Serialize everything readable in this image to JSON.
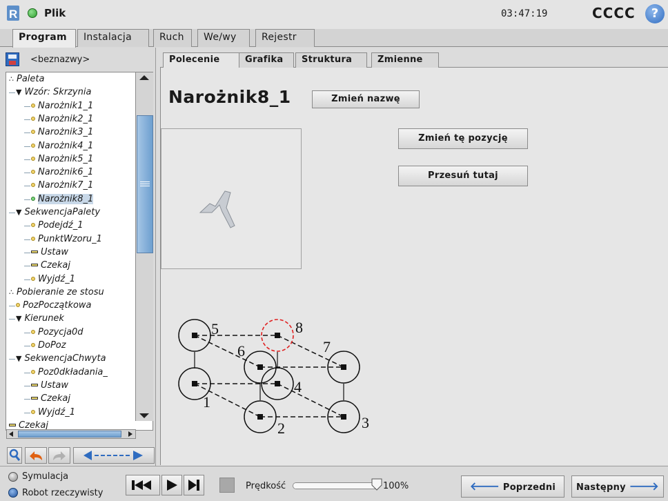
{
  "header": {
    "app_label": "Plik",
    "time": "03:47:19",
    "robot_name": "CCCC",
    "help_glyph": "?"
  },
  "main_tabs": [
    "Program",
    "Instalacja",
    "Ruch",
    "We/wy",
    "Rejestr"
  ],
  "program_name": "<beznazwy>",
  "tree": [
    {
      "label": "Paleta",
      "icon": "group",
      "indent": 0
    },
    {
      "label": "Wzór: Skrzynia",
      "icon": "expand",
      "indent": 1
    },
    {
      "label": "Narożnik1_1",
      "icon": "waypoint",
      "indent": 2
    },
    {
      "label": "Narożnik2_1",
      "icon": "waypoint",
      "indent": 2
    },
    {
      "label": "Narożnik3_1",
      "icon": "waypoint",
      "indent": 2
    },
    {
      "label": "Narożnik4_1",
      "icon": "waypoint",
      "indent": 2
    },
    {
      "label": "Narożnik5_1",
      "icon": "waypoint",
      "indent": 2
    },
    {
      "label": "Narożnik6_1",
      "icon": "waypoint",
      "indent": 2
    },
    {
      "label": "Narożnik7_1",
      "icon": "waypoint",
      "indent": 2
    },
    {
      "label": "Narożnik8_1",
      "icon": "waypoint-selected",
      "indent": 2
    },
    {
      "label": "SekwencjaPalety",
      "icon": "expand",
      "indent": 1
    },
    {
      "label": "Podejdź_1",
      "icon": "waypoint",
      "indent": 2
    },
    {
      "label": "PunktWzoru_1",
      "icon": "waypoint",
      "indent": 2
    },
    {
      "label": "Ustaw",
      "icon": "dash",
      "indent": 2
    },
    {
      "label": "Czekaj",
      "icon": "dash",
      "indent": 2
    },
    {
      "label": "Wyjdź_1",
      "icon": "waypoint",
      "indent": 2
    },
    {
      "label": "Pobieranie ze stosu",
      "icon": "group",
      "indent": 0
    },
    {
      "label": "PozPoczątkowa",
      "icon": "waypoint",
      "indent": 1
    },
    {
      "label": "Kierunek",
      "icon": "expand",
      "indent": 1
    },
    {
      "label": "Pozycja0d",
      "icon": "waypoint",
      "indent": 2
    },
    {
      "label": "DoPoz",
      "icon": "waypoint",
      "indent": 2
    },
    {
      "label": "SekwencjaChwyta",
      "icon": "expand",
      "indent": 1
    },
    {
      "label": "Poz0dkładania_",
      "icon": "waypoint",
      "indent": 2
    },
    {
      "label": "Ustaw",
      "icon": "dash",
      "indent": 2
    },
    {
      "label": "Czekaj",
      "icon": "dash",
      "indent": 2
    },
    {
      "label": "Wyjdź_1",
      "icon": "waypoint",
      "indent": 2
    },
    {
      "label": "Czekaj",
      "icon": "dash",
      "indent": 0
    }
  ],
  "inner_tabs": [
    "Polecenie",
    "Grafika",
    "Struktura",
    "Zmienne"
  ],
  "command": {
    "title": "Narożnik8_1",
    "rename_label": "Zmień nazwę",
    "change_position_label": "Zmień tę pozycję",
    "move_here_label": "Przesuń tutaj"
  },
  "diagram_labels": [
    "5",
    "8",
    "6",
    "7",
    "4",
    "1",
    "2",
    "3"
  ],
  "bottom": {
    "sim_label": "Symulacja",
    "real_label": "Robot rzeczywisty",
    "speed_label": "Prędkość",
    "speed_value": "100%",
    "speed_fraction": 1.0,
    "prev_label": "Poprzedni",
    "next_label": "Następny"
  },
  "colors": {
    "accent_blue": "#3a7ecf",
    "highlight_red": "#e02020",
    "status_green": "#2ea02e"
  }
}
